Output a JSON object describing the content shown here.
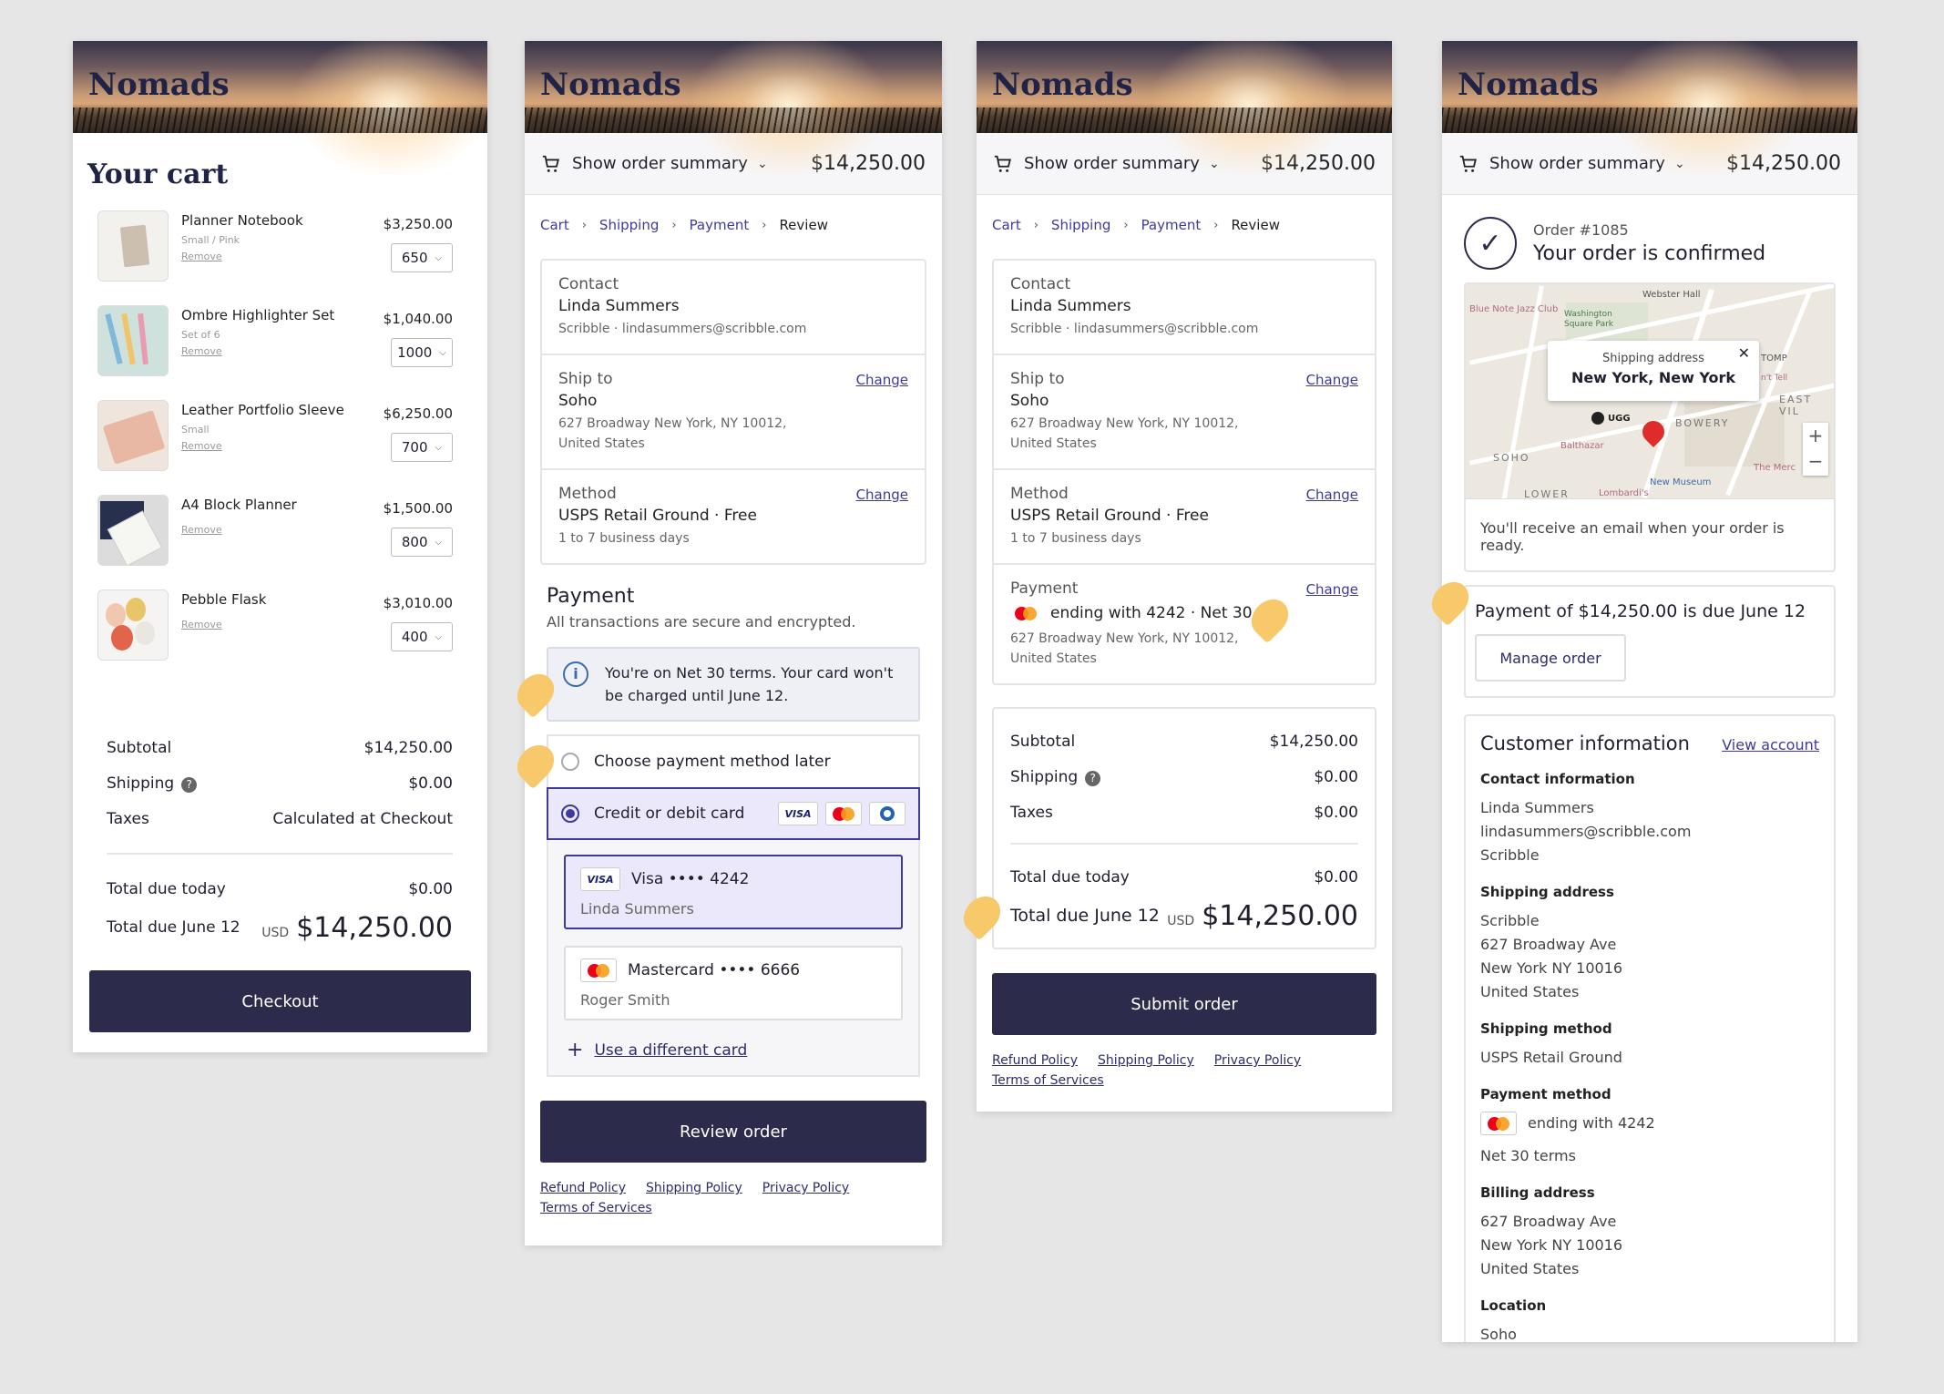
{
  "brand": "Nomads",
  "summary": {
    "label": "Show order summary",
    "total": "$14,250.00"
  },
  "cart": {
    "title": "Your cart",
    "items": [
      {
        "name": "Planner Notebook",
        "variant": "Small / Pink",
        "remove": "Remove",
        "price": "$3,250.00",
        "qty": "650"
      },
      {
        "name": "Ombre Highlighter Set",
        "variant": "Set of 6",
        "remove": "Remove",
        "price": "$1,040.00",
        "qty": "1000"
      },
      {
        "name": "Leather Portfolio Sleeve",
        "variant": "Small",
        "remove": "Remove",
        "price": "$6,250.00",
        "qty": "700"
      },
      {
        "name": "A4 Block Planner",
        "variant": "",
        "remove": "Remove",
        "price": "$1,500.00",
        "qty": "800"
      },
      {
        "name": "Pebble Flask",
        "variant": "",
        "remove": "Remove",
        "price": "$3,010.00",
        "qty": "400"
      }
    ],
    "subtotal_label": "Subtotal",
    "subtotal": "$14,250.00",
    "shipping_label": "Shipping",
    "shipping": "$0.00",
    "taxes_label": "Taxes",
    "taxes": "Calculated at Checkout",
    "due_today_label": "Total due today",
    "due_today": "$0.00",
    "due_later_label": "Total due June 12",
    "currency": "USD",
    "due_later": "$14,250.00",
    "checkout": "Checkout"
  },
  "crumbs": {
    "cart": "Cart",
    "shipping": "Shipping",
    "payment": "Payment",
    "review": "Review"
  },
  "contact": {
    "label": "Contact",
    "name": "Linda Summers",
    "detail": "Scribble · lindasummers@scribble.com"
  },
  "shipto": {
    "label": "Ship to",
    "change": "Change",
    "name": "Soho",
    "address": "627 Broadway New York, NY 10012, United States"
  },
  "method": {
    "label": "Method",
    "change": "Change",
    "name": "USPS Retail Ground · Free",
    "detail": "1 to 7 business days"
  },
  "payment": {
    "title": "Payment",
    "subtitle": "All transactions are secure and encrypted.",
    "notice": "You're on Net 30 terms. Your card won't be charged until June 12.",
    "later": "Choose payment method later",
    "card_option": "Credit or debit card",
    "visa_brand": "VISA",
    "visa_label": "Visa •••• 4242",
    "visa_holder": "Linda Summers",
    "mc_label": "Mastercard •••• 6666",
    "mc_holder": "Roger Smith",
    "different": "Use a different card",
    "review_btn": "Review order"
  },
  "review": {
    "pay_label": "Payment",
    "change": "Change",
    "pay_value": "ending with 4242 · Net 30",
    "pay_address": "627 Broadway New York, NY 10012, United States",
    "subtotal_label": "Subtotal",
    "subtotal": "$14,250.00",
    "shipping_label": "Shipping",
    "shipping": "$0.00",
    "taxes_label": "Taxes",
    "taxes": "$0.00",
    "due_today_label": "Total due today",
    "due_today": "$0.00",
    "due_later_label": "Total due June 12",
    "currency": "USD",
    "due_later": "$14,250.00",
    "submit": "Submit order"
  },
  "footer": {
    "refund": "Refund Policy",
    "shipping": "Shipping Policy",
    "privacy": "Privacy Policy",
    "terms": "Terms of Services"
  },
  "confirm": {
    "order": "Order #1085",
    "title": "Your order is confirmed",
    "map_bubble_label": "Shipping address",
    "map_bubble_value": "New York, New York",
    "map_labels": {
      "jazz": "Blue Note Jazz Club",
      "webster": "Webster Hall",
      "wsp": "Washington Square Park",
      "eastvil": "EAST VIL",
      "bowery": "BOWERY",
      "soho": "SOHO",
      "balthazar": "Balthazar",
      "ugg": "UGG",
      "newmuseum": "New Museum",
      "lower": "LOWER",
      "lombardi": "Lombardi's",
      "themerc": "The Merc",
      "tomp": "TOMP",
      "inttell": "n't Tell"
    },
    "email_note": "You'll receive an email when your order is ready.",
    "payment_due": "Payment of $14,250.00 is due June 12",
    "manage": "Manage order",
    "ci_title": "Customer information",
    "view_account": "View account",
    "contact_h": "Contact information",
    "contact": [
      "Linda Summers",
      "lindasummers@scribble.com",
      "Scribble"
    ],
    "ship_h": "Shipping address",
    "ship": [
      "Scribble",
      "627 Broadway Ave",
      "New York NY 10016",
      "United States"
    ],
    "method_h": "Shipping method",
    "method": "USPS Retail Ground",
    "pay_h": "Payment method",
    "pay": "ending with 4242",
    "terms": "Net 30 terms",
    "bill_h": "Billing address",
    "bill": [
      "627 Broadway Ave",
      "New York NY 10016",
      "United States"
    ],
    "loc_h": "Location",
    "loc": "Soho"
  },
  "colors": {
    "accent": "#3d3a9c",
    "button": "#2d2b4c",
    "highlight": "#f7c96a",
    "selected_bg": "#ebe8fb"
  }
}
